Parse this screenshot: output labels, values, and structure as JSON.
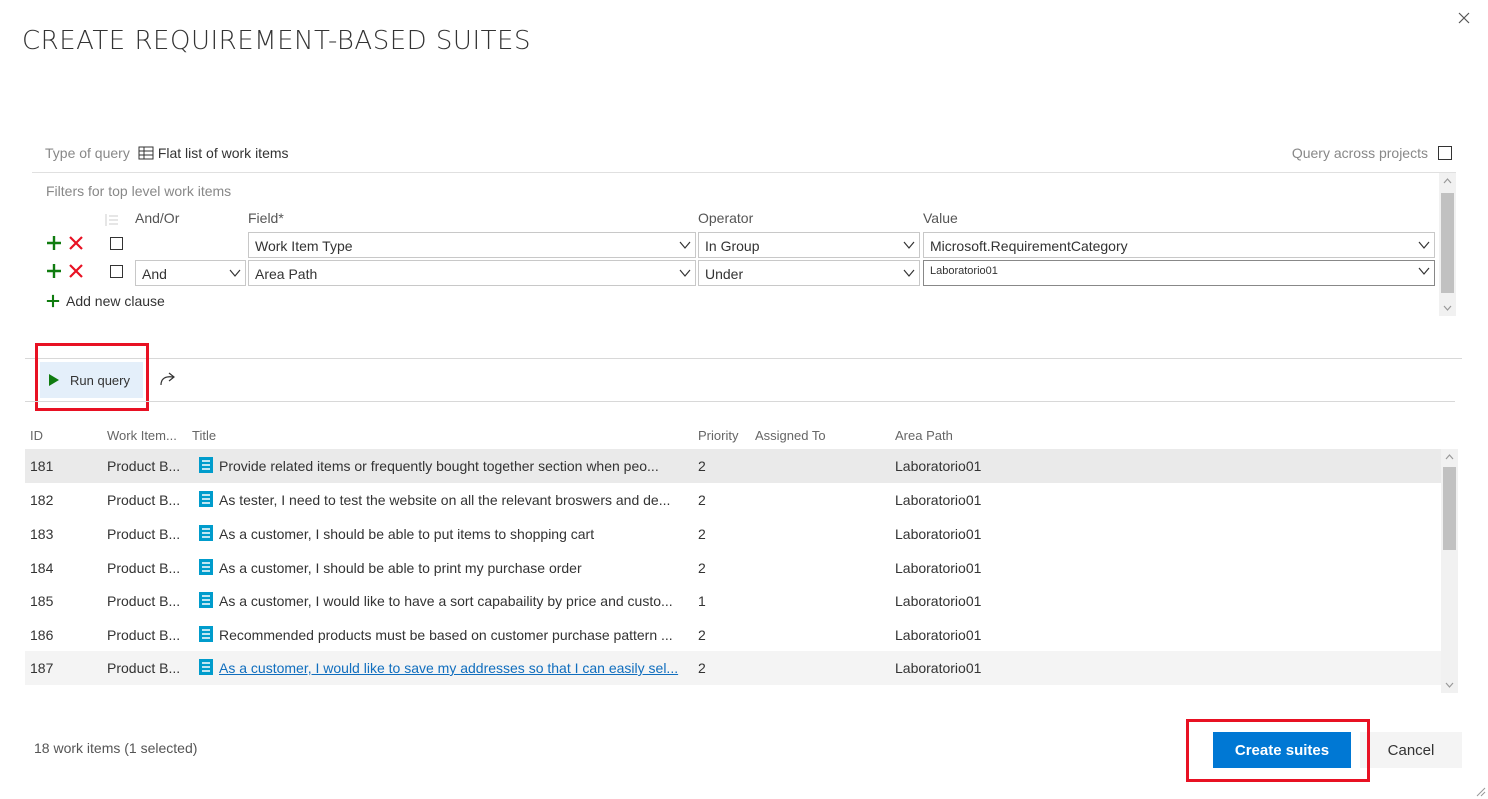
{
  "dialog": {
    "title": "CREATE REQUIREMENT-BASED SUITES"
  },
  "query_type": {
    "label": "Type of query",
    "value": "Flat list of work items",
    "icon": "table-icon"
  },
  "cross_projects": {
    "label": "Query across projects",
    "checked": false
  },
  "filters": {
    "title": "Filters for top level work items",
    "headers": {
      "and_or": "And/Or",
      "field": "Field*",
      "operator": "Operator",
      "value": "Value"
    },
    "rows": [
      {
        "and_or": "",
        "field": "Work Item Type",
        "operator": "In Group",
        "value": "Microsoft.RequirementCategory"
      },
      {
        "and_or": "And",
        "field": "Area Path",
        "operator": "Under",
        "value": "Laboratorio01"
      }
    ],
    "add_clause": "Add new clause"
  },
  "toolbar": {
    "run_query": "Run query",
    "redo_icon": "redo-icon"
  },
  "results": {
    "columns": {
      "id": "ID",
      "type": "Work Item...",
      "title": "Title",
      "priority": "Priority",
      "assigned": "Assigned To",
      "area": "Area Path"
    },
    "rows": [
      {
        "id": "181",
        "type": "Product B...",
        "title": "Provide related items or frequently bought together section when peo...",
        "priority": "2",
        "assigned": "",
        "area": "Laboratorio01"
      },
      {
        "id": "182",
        "type": "Product B...",
        "title": "As tester, I need to test the website on all the relevant broswers and de...",
        "priority": "2",
        "assigned": "",
        "area": "Laboratorio01"
      },
      {
        "id": "183",
        "type": "Product B...",
        "title": "As a customer, I should be able to put items to shopping cart",
        "priority": "2",
        "assigned": "",
        "area": "Laboratorio01"
      },
      {
        "id": "184",
        "type": "Product B...",
        "title": "As a customer, I should be able to print my purchase order",
        "priority": "2",
        "assigned": "",
        "area": "Laboratorio01"
      },
      {
        "id": "185",
        "type": "Product B...",
        "title": "As a customer, I would like to have a sort capabaility by price and custo...",
        "priority": "1",
        "assigned": "",
        "area": "Laboratorio01"
      },
      {
        "id": "186",
        "type": "Product B...",
        "title": "Recommended products must be based on customer purchase pattern ...",
        "priority": "2",
        "assigned": "",
        "area": "Laboratorio01"
      },
      {
        "id": "187",
        "type": "Product B...",
        "title": "As a customer, I would like to save my addresses so that I can easily sel...",
        "priority": "2",
        "assigned": "",
        "area": "Laboratorio01"
      }
    ]
  },
  "footer": {
    "status": "18 work items (1 selected)",
    "create": "Create suites",
    "cancel": "Cancel"
  },
  "colors": {
    "accent": "#0078d4",
    "highlight": "#e81123",
    "add_green": "#107c10",
    "delete_red": "#e81123",
    "link": "#106ebe"
  }
}
